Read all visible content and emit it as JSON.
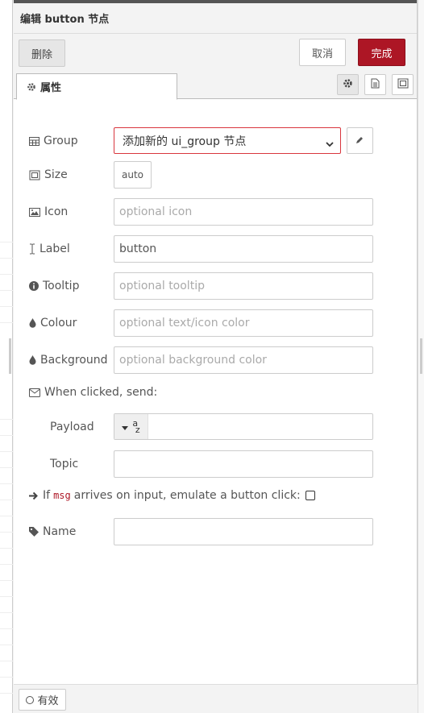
{
  "header": {
    "title": "编辑 button 节点"
  },
  "toolbar": {
    "delete_label": "删除",
    "cancel_label": "取消",
    "done_label": "完成",
    "done_color": "#ad1625"
  },
  "tabs": {
    "properties_label": "属性"
  },
  "form": {
    "group": {
      "label": "Group",
      "value": "添加新的 ui_group 节点"
    },
    "size": {
      "label": "Size",
      "value": "auto"
    },
    "icon": {
      "label": "Icon",
      "placeholder": "optional icon"
    },
    "label_field": {
      "label": "Label",
      "value": "button"
    },
    "tooltip": {
      "label": "Tooltip",
      "placeholder": "optional tooltip"
    },
    "colour": {
      "label": "Colour",
      "placeholder": "optional text/icon color"
    },
    "background": {
      "label": "Background",
      "placeholder": "optional background color"
    },
    "when_clicked": {
      "label": "When clicked, send:"
    },
    "payload": {
      "label": "Payload",
      "type_top": "a",
      "type_bottom": "z"
    },
    "topic": {
      "label": "Topic",
      "value": ""
    },
    "emulate": {
      "prefix": "If",
      "code": "msg",
      "suffix": "arrives on input, emulate a button click:"
    },
    "name": {
      "label": "Name",
      "value": ""
    }
  },
  "footer": {
    "enable_label": "有效"
  }
}
